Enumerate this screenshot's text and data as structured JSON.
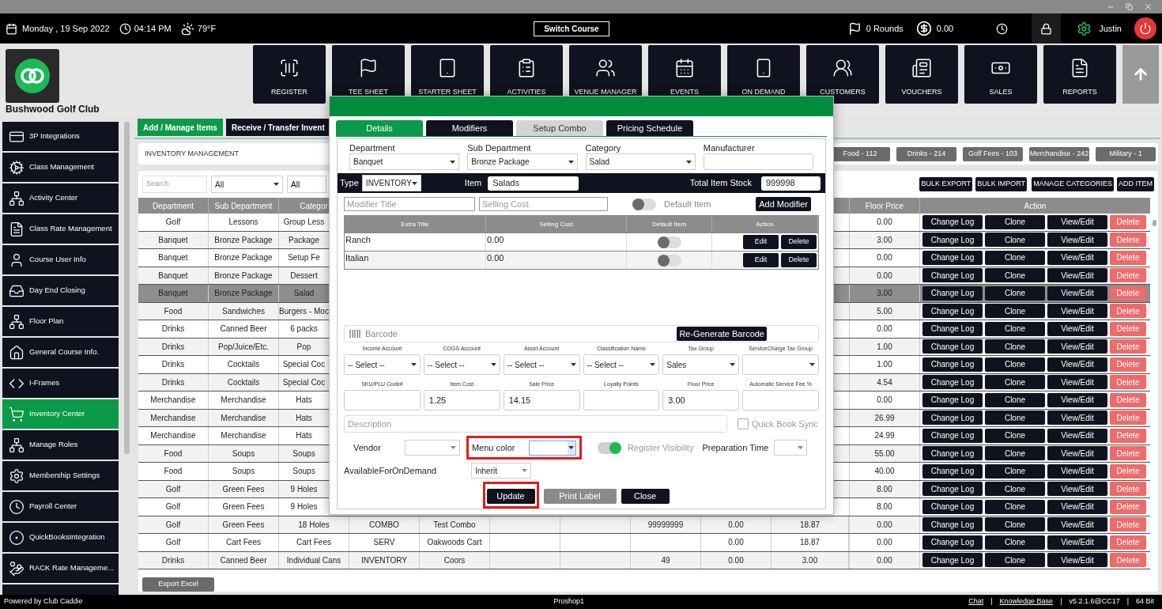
{
  "top_bar": {
    "date": "Monday , 19 Sep 2022",
    "time": "04:14 PM",
    "weather": "79°F",
    "switch_course": "Switch Course",
    "rounds": "0 Rounds",
    "balance": "0.00",
    "user": "Justin"
  },
  "club": {
    "name": "Bushwood Golf Club"
  },
  "nav": [
    {
      "label": "REGISTER"
    },
    {
      "label": "TEE SHEET"
    },
    {
      "label": "STARTER SHEET"
    },
    {
      "label": "ACTIVITIES"
    },
    {
      "label": "VENUE MANAGER"
    },
    {
      "label": "EVENTS"
    },
    {
      "label": "ON DEMAND"
    },
    {
      "label": "CUSTOMERS"
    },
    {
      "label": "VOUCHERS"
    },
    {
      "label": "SALES"
    },
    {
      "label": "REPORTS"
    }
  ],
  "sidebar": {
    "items": [
      {
        "label": "3P Integrations",
        "selected": false
      },
      {
        "label": "Class Management",
        "selected": false
      },
      {
        "label": "Activity  Center",
        "selected": false
      },
      {
        "label": "Class Rate Management",
        "selected": false
      },
      {
        "label": "Course User Info",
        "selected": false
      },
      {
        "label": "Day End Closing",
        "selected": false
      },
      {
        "label": "Floor Plan",
        "selected": false
      },
      {
        "label": "General Course Info.",
        "selected": false
      },
      {
        "label": "I-Frames",
        "selected": false
      },
      {
        "label": "Inventory Center",
        "selected": true
      },
      {
        "label": "Manage Roles",
        "selected": false
      },
      {
        "label": "Membership Settings",
        "selected": false
      },
      {
        "label": "Payroll Center",
        "selected": false
      },
      {
        "label": "QuickBooksIntegration",
        "selected": false
      },
      {
        "label": "RACK Rate Manageme...",
        "selected": false
      },
      {
        "selected": false
      }
    ]
  },
  "tabs": [
    {
      "label": "Add / Manage Items",
      "selected": true
    },
    {
      "label": "Receive / Transfer Invent",
      "selected": false
    }
  ],
  "panel_title": "INVENTORY MANAGEMENT",
  "category_counts": [
    "Food - 112",
    "Drinks - 214",
    "Golf Fees - 103",
    "Merchandise - 242",
    "Military - 1"
  ],
  "filters": {
    "search_placeholder": "Search",
    "selects": [
      "All",
      "All"
    ]
  },
  "toolbar": [
    "BULK EXPORT",
    "BULK IMPORT",
    "MANAGE CATEGORIES",
    "ADD ITEM"
  ],
  "table": {
    "columns": [
      "Department",
      "Sub Department",
      "Categor",
      "Floor Price",
      "Action"
    ],
    "rows": [
      {
        "cells": [
          "Golf",
          "Lessons",
          "Group Less"
        ],
        "floor_price": "0.00",
        "selected": false,
        "actions": [
          "Change Log",
          "Clone",
          "View/Edit",
          "Delete"
        ]
      },
      {
        "cells": [
          "Banquet",
          "Bronze Package",
          "Package"
        ],
        "floor_price": "3.00",
        "selected": false,
        "actions": [
          "Change Log",
          "Clone",
          "View/Edit",
          "Delete"
        ]
      },
      {
        "cells": [
          "Banquet",
          "Bronze Package",
          "Setup Fe"
        ],
        "floor_price": "0.00",
        "selected": false,
        "actions": [
          "Change Log",
          "Clone",
          "View/Edit",
          "Delete"
        ]
      },
      {
        "cells": [
          "Banquet",
          "Bronze Package",
          "Dessert"
        ],
        "floor_price": "0.00",
        "selected": false,
        "actions": [
          "Change Log",
          "Clone",
          "View/Edit",
          "Delete"
        ]
      },
      {
        "cells": [
          "Banquet",
          "Bronze Package",
          "Salad"
        ],
        "floor_price": "3.00",
        "selected": true,
        "actions": [
          "Change Log",
          "Clone",
          "View/Edit",
          "Delete"
        ]
      },
      {
        "cells": [
          "Food",
          "Sandwiches",
          "Burgers - Moc"
        ],
        "floor_price": "5.00",
        "selected": false,
        "actions": [
          "Change Log",
          "Clone",
          "View/Edit",
          "Delete"
        ]
      },
      {
        "cells": [
          "Drinks",
          "Canned Beer",
          "6 packs"
        ],
        "floor_price": "0.00",
        "selected": false,
        "actions": [
          "Change Log",
          "Clone",
          "View/Edit",
          "Delete"
        ]
      },
      {
        "cells": [
          "Drinks",
          "Pop/Juice/Etc.",
          "Pop"
        ],
        "floor_price": "1.00",
        "selected": false,
        "actions": [
          "Change Log",
          "Clone",
          "View/Edit",
          "Delete"
        ]
      },
      {
        "cells": [
          "Drinks",
          "Cocktails",
          "Special Coc"
        ],
        "floor_price": "1.00",
        "selected": false,
        "actions": [
          "Change Log",
          "Clone",
          "View/Edit",
          "Delete"
        ]
      },
      {
        "cells": [
          "Drinks",
          "Cocktails",
          "Special Coc"
        ],
        "floor_price": "4.54",
        "selected": false,
        "actions": [
          "Change Log",
          "Clone",
          "View/Edit",
          "Delete"
        ]
      },
      {
        "cells": [
          "Merchandise",
          "Merchandise",
          "Hats"
        ],
        "floor_price": "0.00",
        "selected": false,
        "actions": [
          "Change Log",
          "Clone",
          "View/Edit",
          "Delete"
        ]
      },
      {
        "cells": [
          "Merchandise",
          "Merchandise",
          "Hats"
        ],
        "floor_price": "26.99",
        "selected": false,
        "actions": [
          "Change Log",
          "Clone",
          "View/Edit",
          "Delete"
        ]
      },
      {
        "cells": [
          "Merchandise",
          "Merchandise",
          "Hats"
        ],
        "floor_price": "24.99",
        "selected": false,
        "actions": [
          "Change Log",
          "Clone",
          "View/Edit",
          "Delete"
        ]
      },
      {
        "cells": [
          "Food",
          "Soups",
          "Soups"
        ],
        "floor_price": "55.00",
        "selected": false,
        "actions": [
          "Change Log",
          "Clone",
          "View/Edit",
          "Delete"
        ]
      },
      {
        "cells": [
          "Food",
          "Soups",
          "Soups"
        ],
        "floor_price": "40.00",
        "selected": false,
        "actions": [
          "Change Log",
          "Clone",
          "View/Edit",
          "Delete"
        ]
      },
      {
        "cells": [
          "Golf",
          "Green Fees",
          "9 Holes"
        ],
        "floor_price": "8.00",
        "selected": false,
        "actions": [
          "Change Log",
          "Clone",
          "View/Edit",
          "Delete"
        ]
      },
      {
        "cells": [
          "Golf",
          "Green Fees",
          "9 Holes"
        ],
        "floor_price": "8.00",
        "selected": false,
        "actions": [
          "Change Log",
          "Clone",
          "View/Edit",
          "Delete"
        ]
      },
      {
        "cells": [
          "Golf",
          "Green Fees",
          "18 Holes",
          "COMBO",
          "Test Combo",
          null,
          null,
          "99999999",
          "0.00",
          "18.87"
        ],
        "floor_price": "0.00",
        "selected": false,
        "actions": [
          "Change Log",
          "Clone",
          "View/Edit",
          "Delete"
        ]
      },
      {
        "cells": [
          "Golf",
          "Cart Fees",
          "Cart Fees",
          "SERV",
          "Oakwoods Cart",
          null,
          null,
          null,
          "0.00",
          "18.87"
        ],
        "floor_price": "0.00",
        "selected": false,
        "actions": [
          "Change Log",
          "Clone",
          "View/Edit",
          "Delete"
        ]
      },
      {
        "cells": [
          "Drinks",
          "Canned Beer",
          "Individual Cans",
          "INVENTORY",
          "Coors",
          null,
          null,
          "49",
          "0.00",
          "3.00"
        ],
        "floor_price": "0.00",
        "selected": false,
        "actions": [
          "Change Log",
          "Clone",
          "View/Edit",
          "Delete"
        ]
      }
    ]
  },
  "export_button": "Export Excel",
  "footer": {
    "powered": "Powered by Club Caddie",
    "station": "Proshop1",
    "items": [
      {
        "kind": "link",
        "text": "Chat"
      },
      {
        "kind": "sep",
        "text": "|"
      },
      {
        "kind": "link",
        "text": "Knowledge Base"
      },
      {
        "kind": "sep",
        "text": "|"
      },
      {
        "kind": "text",
        "text": "v5.2.1.6@CC17"
      },
      {
        "kind": "sep",
        "text": "|"
      },
      {
        "kind": "text",
        "text": "64 Bit"
      }
    ]
  },
  "dialog": {
    "tabs": [
      {
        "label": "Details",
        "selected": true,
        "disabled": false
      },
      {
        "label": "Modifiers",
        "selected": false,
        "disabled": false
      },
      {
        "label": "Setup Combo",
        "selected": false,
        "disabled": true
      },
      {
        "label": "Pricing Schedule",
        "selected": false,
        "disabled": false
      }
    ],
    "top_fields": [
      {
        "label": "Department",
        "kind": "select",
        "value": "Banquet"
      },
      {
        "label": "Sub Department",
        "kind": "select",
        "value": "Bronze Package"
      },
      {
        "label": "Category",
        "kind": "select",
        "value": "Salad"
      },
      {
        "label": "Manufacturer",
        "kind": "input"
      }
    ],
    "type": {
      "label": "Type",
      "value": "INVENTORY"
    },
    "item": {
      "label": "Item",
      "value": "Salads"
    },
    "stock": {
      "label": "Total Item Stock",
      "value": "999998"
    },
    "modifier_form": {
      "title_placeholder": "Modifier Title",
      "cost_placeholder": "Selling Cost",
      "default_label": "Default Item",
      "default_on": false,
      "add_button": "Add Modifier"
    },
    "modifiers": {
      "columns": [
        "Extra Title",
        "Selling Cost",
        "Default Item",
        "Action"
      ],
      "rows": [
        {
          "title": "Ranch",
          "cost": "0.00",
          "default": false,
          "actions": [
            "Edit",
            "Delete"
          ]
        },
        {
          "title": "Italian",
          "cost": "0.00",
          "default": false,
          "actions": [
            "Edit",
            "Delete"
          ]
        }
      ]
    },
    "barcode": {
      "placeholder": "Barcode",
      "button": "Re-Generate Barcode"
    },
    "accounts": [
      {
        "label": "Income Account",
        "value": "-- Select --"
      },
      {
        "label": "COGS Account",
        "value": "-- Select --"
      },
      {
        "label": "Asset Account",
        "value": "-- Select --"
      },
      {
        "label": "Classification Name",
        "value": "-- Select --"
      },
      {
        "label": "Tax Group",
        "value": "Sales"
      },
      {
        "label": "ServiceCharge Tax Group"
      }
    ],
    "prices": [
      {
        "label": "SKU/PLU Code#"
      },
      {
        "label": "Item Cost",
        "value": "1.25"
      },
      {
        "label": "Sale Price",
        "value": "14.15"
      },
      {
        "label": "Loyalty Points"
      },
      {
        "label": "Floor Price",
        "value": "3.00"
      },
      {
        "label": "Automatic Service Fee %"
      }
    ],
    "description": {
      "placeholder": "Description"
    },
    "quick_book_sync": {
      "label": "Quick Book Sync",
      "checked": false
    },
    "vendor": {
      "label": "Vendor"
    },
    "menu_color": {
      "label": "Menu color",
      "highlighted": true
    },
    "register_visibility": {
      "label": "Register Visibility",
      "on": true
    },
    "preparation_time": {
      "label": "Preparation Time"
    },
    "on_demand": {
      "label": "AvailableForOnDemand",
      "value": "Inherit"
    },
    "buttons": [
      {
        "label": "Update",
        "kind": "primary",
        "highlighted": true
      },
      {
        "label": "Print Label",
        "kind": "secondary",
        "highlighted": false
      },
      {
        "label": "Close",
        "kind": "primary",
        "highlighted": false
      }
    ]
  }
}
